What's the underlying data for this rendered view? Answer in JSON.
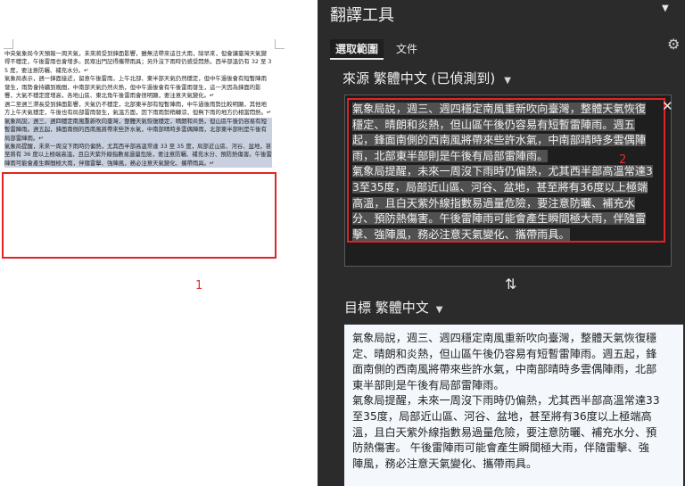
{
  "document": {
    "paragraphs": [
      {
        "text": "中央氣象局今天預報一周天氣，未來將受到鋒面影響，雖無法帶來這日大雨，除早來，但會讓臺灣天氣變得不穩定，午後雷雨也會增多。民眾出門記得攜帶雨具；另外沒下雨時仍感受悶熱，西半部溫仍有 32 至 35 度，要注意防曬、補充水分。↵",
        "selected": false
      },
      {
        "text": "氣象局表示，週一鋒面接近，留意午後雷雨，上午北部、東半部天氣仍然穩定，但中午過後會有短暫陣雨發生，雨勢會持續到晚間，中南部天氣仍然炎熱，但中午過後會有午後雷雨發生，這一天因為鋒面的影響，大氣不穩定度增高，各地山區、東北角午後雷雨會很明顯，要注意天氣變化。↵",
        "selected": false
      },
      {
        "text": "週二至週三滯長受到鋒面影響，天氣仍不穩定，北部東半部有短暫陣雨，中午過後雨勢比較明顯，其他地方上午天氣穩定，午後也有局部雷雨發生，氣溫方面，因下雨雨勢稍轉涼，但無下雨的地方仍相當悶熱。↵",
        "selected": false
      },
      {
        "text": "氣象局說，週三、週四穩定南風重新吹向臺灣，整體天氣恢復穩定，晴朗和炎熱，但山區午後仍容易有短暫雷陣雨。週五起，鋒面南側的西南風將帶來些許水氣，中南部晴時多雲偶陣雨，北部東半部則是午後有局部雷陣雨。↵",
        "selected": true
      },
      {
        "text": "氣象局提醒，未來一周沒下雨時仍偏熱，尤其西半部高溫常達 33 至 35 度，局部近山區、河谷、盆地，甚至將有 36 度以上極端高溫，且白天紫外線指數易過量危險，要注意防曬、補充水分、預防熱傷害。午後雷陣雨可能會產生瞬間極大雨，伴隨雷擊、強陣風，務必注意天氣變化、攜帶雨具。↵",
        "selected": true
      }
    ],
    "annotation_number": "1"
  },
  "pane": {
    "title": "翻譯工具",
    "menu_icon": "caret-down-icon",
    "tabs": [
      {
        "label": "選取範圍",
        "selected": true
      },
      {
        "label": "文件",
        "selected": false
      }
    ],
    "settings_icon": "gear-icon",
    "source": {
      "label": "來源 繁體中文 (已偵測到)",
      "paragraphs": [
        "氣象局說，週三、週四穩定南風重新吹向臺灣，整體天氣恢復穩定、晴朗和炎熱，但山區午後仍容易有短暫雷陣雨。週五起，鋒面南側的西南風將帶來些許水氣，中南部晴時多雲偶陣雨，北部東半部則是午後有局部雷陣雨。",
        "氣象局提醒，未來一周沒下雨時仍偏熱，尤其西半部高溫常達33至35度，局部近山區、河谷、盆地，甚至將有36度以上極端高溫，且白天紫外線指數易過量危險，要注意防曬、補充水分、預防熱傷害。午後雷陣雨可能會產生瞬間極大雨，伴隨雷擊、強陣風，務必注意天氣變化、攜帶雨具。"
      ],
      "annotation_number": "2",
      "clear_symbol": "✕"
    },
    "swap_symbol": "⇅",
    "target": {
      "label": "目標 繁體中文",
      "paragraphs": [
        "氣象局說，週三、週四穩定南風重新吹向臺灣，整體天氣恢復穩定、晴朗和炎熱，但山區午後仍容易有短暫雷陣雨。週五起，鋒面南側的西南風將帶來些許水氣，中南部晴時多雲偶陣雨，北部東半部則是午後有局部雷陣雨。",
        "氣象局提醒，未來一周沒下雨時仍偏熱，尤其西半部高溫常達33至35度，局部近山區、河谷、盆地，甚至將有36度以上極端高溫，且白天紫外線指數易過量危險，要注意防曬、補充水分、預防熱傷害。 午後雷陣雨可能會產生瞬間極大雨，伴隨雷擊、強陣風，務必注意天氣變化、攜帶雨具。"
      ]
    },
    "colors": {
      "pane_bg": "#2b2b2b",
      "highlight_box": "#e02424",
      "doc_selection": "#c9d1e0"
    }
  }
}
